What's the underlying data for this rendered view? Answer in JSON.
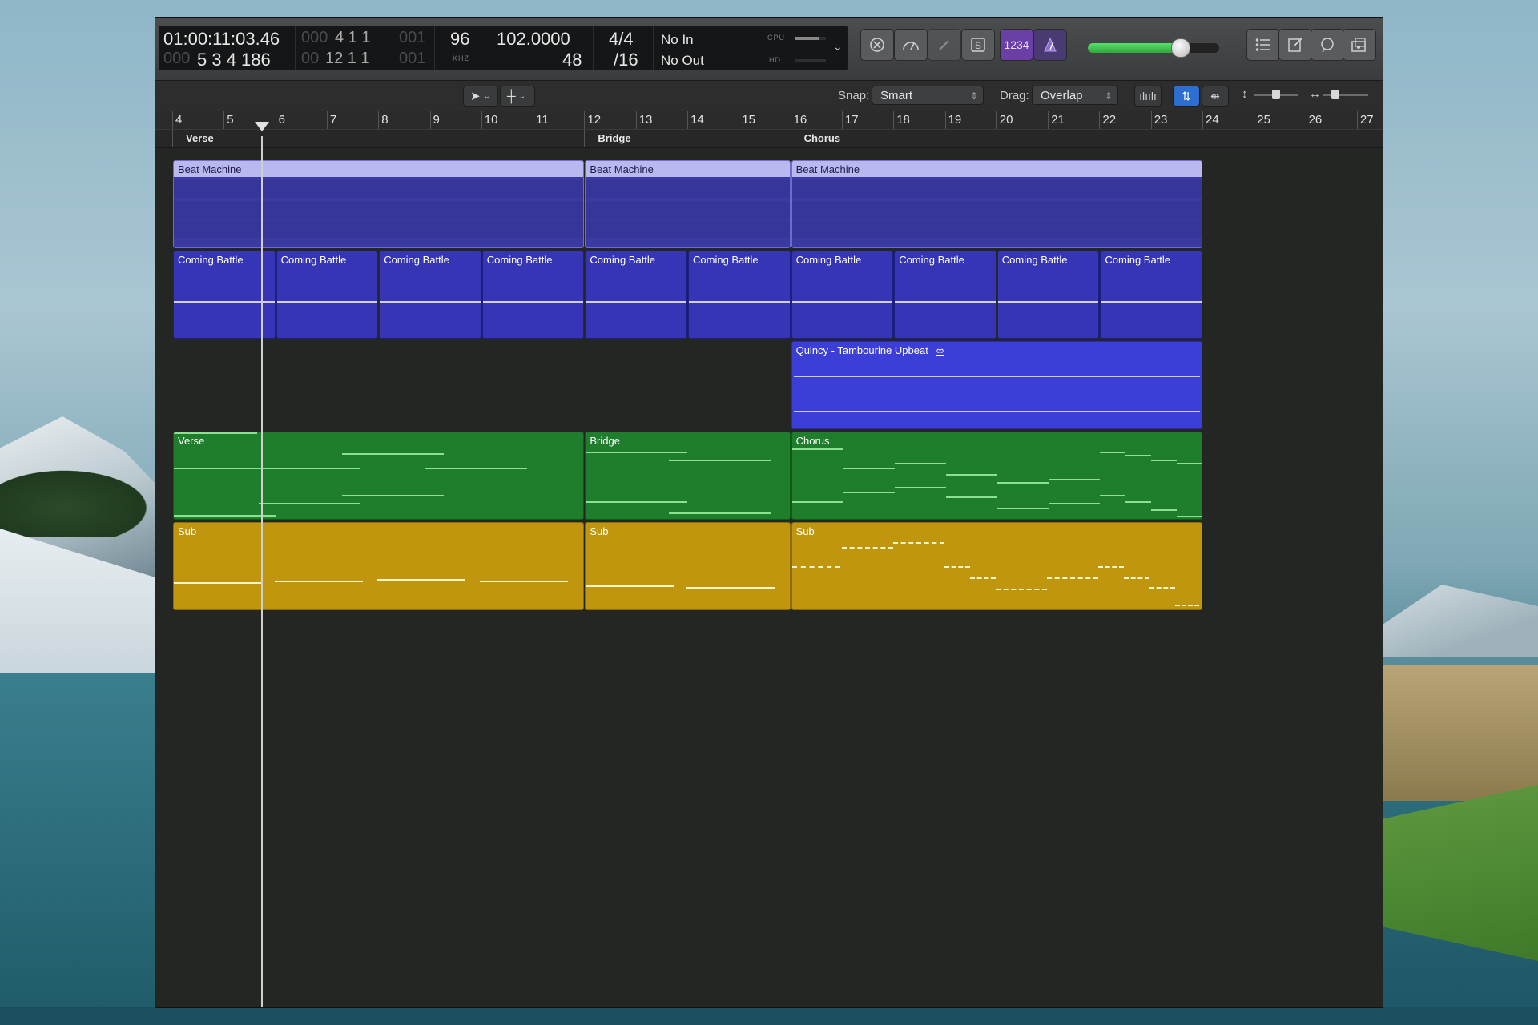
{
  "lcd": {
    "smpte_time": "01:00:11:03.46",
    "bar_position_dim": "000",
    "bar_position": "5 3 4 186",
    "left_locator_dim": "000",
    "left_locator": "4  1  1",
    "left_locator_tail": "001",
    "right_locator_dim": "00",
    "right_locator": "12  1  1",
    "right_locator_tail": "001",
    "sample_rate": "96",
    "sample_rate_unit": "KHZ",
    "tempo": "102.0000",
    "tempo_sub": "48",
    "time_signature": "4/4",
    "division": "/16",
    "midi_in": "No In",
    "midi_out": "No Out",
    "cpu_label": "CPU",
    "hd_label": "HD",
    "cpu_level": 0.75,
    "hd_level": 0.0
  },
  "control_buttons": {
    "count_in_label": "1234",
    "metronome_icon": "metronome-icon"
  },
  "master_volume": 0.7,
  "tracks_toolbar": {
    "snap_label": "Snap:",
    "snap_value": "Smart",
    "drag_label": "Drag:",
    "drag_value": "Overlap"
  },
  "ruler": {
    "bars": [
      "4",
      "5",
      "6",
      "7",
      "8",
      "9",
      "10",
      "11",
      "12",
      "13",
      "14",
      "15",
      "16",
      "17",
      "18",
      "19",
      "20",
      "21",
      "22",
      "23",
      "24",
      "25",
      "26",
      "27"
    ]
  },
  "markers": [
    {
      "label": "Verse"
    },
    {
      "label": "Bridge"
    },
    {
      "label": "Chorus"
    }
  ],
  "tracks": {
    "beat_machine": [
      "Beat Machine",
      "Beat Machine",
      "Beat Machine"
    ],
    "coming_battle": [
      "Coming Battle",
      "Coming Battle",
      "Coming Battle",
      "Coming Battle",
      "Coming Battle",
      "Coming Battle",
      "Coming Battle",
      "Coming Battle",
      "Coming Battle",
      "Coming Battle"
    ],
    "tambourine": "Quincy  -  Tambourine Upbeat",
    "tambourine_loop_icon": "∞",
    "keys": [
      "Verse",
      "Bridge",
      "Chorus"
    ],
    "bass": [
      "Sub",
      "Sub",
      "Sub"
    ]
  },
  "colors": {
    "beat_machine": "#3a3aa0",
    "coming_battle": "#3535b5",
    "tambourine": "#3c3ed8",
    "keys": "#1f7e2b",
    "bass": "#bf960e",
    "count_in_active": "#6a3fa6"
  }
}
